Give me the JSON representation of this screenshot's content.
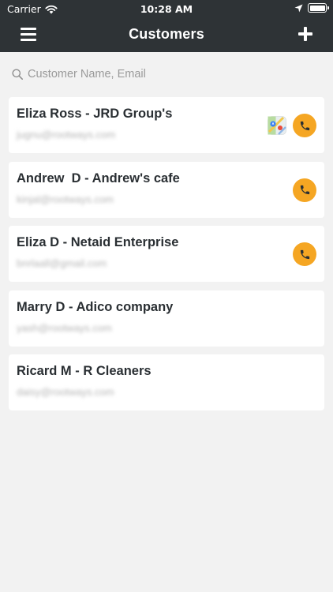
{
  "status_bar": {
    "carrier": "Carrier",
    "time": "10:28 AM"
  },
  "header": {
    "title": "Customers",
    "menu_icon": "hamburger-menu-icon",
    "add_icon": "plus-icon"
  },
  "search": {
    "placeholder": "Customer Name, Email",
    "value": ""
  },
  "colors": {
    "nav_background": "#2e3336",
    "call_accent": "#f5a623",
    "page_background": "#f2f2f2"
  },
  "customers": [
    {
      "name": "Eliza Ross - JRD Group's",
      "email": "jugnu@rootways.com",
      "has_map": true,
      "has_call": true
    },
    {
      "name": "Andrew  D - Andrew's cafe",
      "email": "kinjal@rootways.com",
      "has_map": false,
      "has_call": true
    },
    {
      "name": "Eliza D - Netaid Enterprise",
      "email": "bnrlaall@gmail.com",
      "has_map": false,
      "has_call": true
    },
    {
      "name": "Marry D - Adico company",
      "email": "yash@rootways.com",
      "has_map": false,
      "has_call": false
    },
    {
      "name": "Ricard M - R Cleaners",
      "email": "daisy@rootways.com",
      "has_map": false,
      "has_call": false
    }
  ]
}
